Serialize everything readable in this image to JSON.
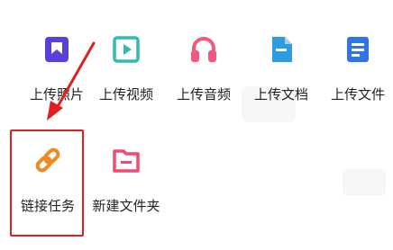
{
  "actions": {
    "upload_photo": "上传照片",
    "upload_video": "上传视频",
    "upload_audio": "上传音频",
    "upload_doc": "上传文档",
    "upload_file": "上传文件",
    "link_task": "链接任务",
    "new_folder": "新建文件夹"
  },
  "icons": {
    "upload_photo": "bookmark-image-icon",
    "upload_video": "play-square-icon",
    "upload_audio": "headphones-icon",
    "upload_doc": "document-icon",
    "upload_file": "file-list-icon",
    "link_task": "chain-link-icon",
    "new_folder": "folder-icon"
  },
  "colors": {
    "photo_icon": "#5b3fd9",
    "video_icon": "#2fbbb0",
    "audio_icon": "#f05a7e",
    "doc_icon": "#2d9ce0",
    "file_icon": "#2f74e8",
    "link_icon": "#f08a24",
    "folder_icon": "#ee4a72",
    "highlight": "#e02020"
  }
}
